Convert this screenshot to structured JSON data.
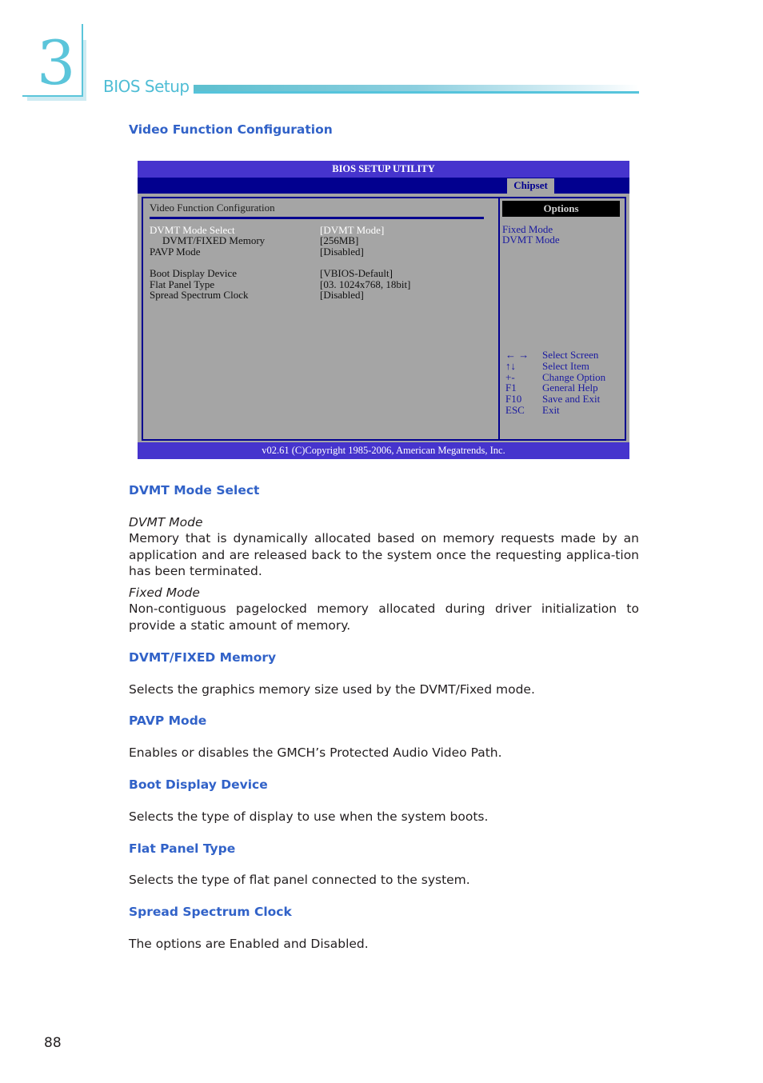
{
  "chapter": {
    "number": "3",
    "title": "BIOS Setup"
  },
  "section_title": "Video Function Configuration",
  "bios": {
    "title": "BIOS SETUP UTILITY",
    "active_tab": "Chipset",
    "panel_title": "Video Function Configuration",
    "items": [
      {
        "label": "DVMT Mode Select",
        "value": "[DVMT Mode]",
        "selected": true
      },
      {
        "label": "DVMT/FIXED Memory",
        "value": "[256MB]"
      },
      {
        "label": "PAVP Mode",
        "value": "[Disabled]"
      },
      {
        "label": "Boot Display Device",
        "value": "[VBIOS-Default]"
      },
      {
        "label": "Flat Panel Type",
        "value": "[03. 1024x768, 18bit]"
      },
      {
        "label": "Spread Spectrum Clock",
        "value": "[Disabled]"
      }
    ],
    "options_header": "Options",
    "options": [
      "Fixed Mode",
      "DVMT Mode"
    ],
    "keys": [
      {
        "key": "← →",
        "desc": "Select Screen"
      },
      {
        "key": "↑↓",
        "desc": "Select Item"
      },
      {
        "key": "+-",
        "desc": "Change Option"
      },
      {
        "key": "F1",
        "desc": "General Help"
      },
      {
        "key": "F10",
        "desc": "Save and Exit"
      },
      {
        "key": "ESC",
        "desc": "Exit"
      }
    ],
    "footer": "v02.61 (C)Copyright 1985-2006, American Megatrends, Inc."
  },
  "sections": {
    "dvmt_mode_select": {
      "heading": "DVMT Mode Select",
      "dvmt_mode_label": "DVMT Mode",
      "dvmt_mode_text": "Memory that is dynamically allocated based on memory requests made by an application and are released back to the system once the requesting applica-tion has been terminated.",
      "fixed_mode_label": "Fixed Mode",
      "fixed_mode_text": "Non-contiguous pagelocked memory allocated during driver initialization to provide a static amount of memory."
    },
    "dvmt_fixed_memory": {
      "heading": "DVMT/FIXED Memory",
      "text": "Selects the graphics memory size used by the DVMT/Fixed mode."
    },
    "pavp_mode": {
      "heading": "PAVP Mode",
      "text": "Enables or disables the GMCH’s Protected Audio Video Path."
    },
    "boot_display_device": {
      "heading": "Boot Display Device",
      "text": "Selects the type of display to use when the system boots."
    },
    "flat_panel_type": {
      "heading": "Flat Panel Type",
      "text": "Selects the type of flat panel connected to the system."
    },
    "spread_spectrum_clock": {
      "heading": "Spread Spectrum Clock",
      "text": "The options are Enabled and Disabled."
    }
  },
  "page_number": "88"
}
